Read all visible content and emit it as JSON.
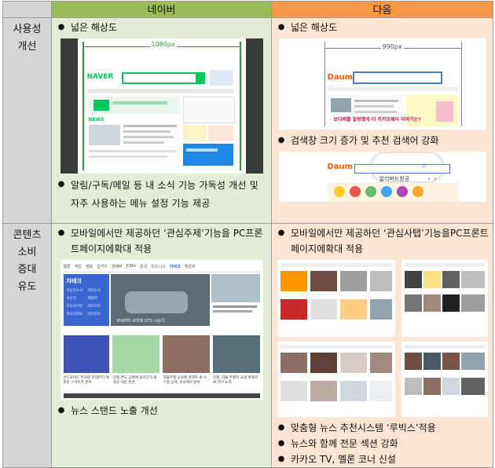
{
  "header": {
    "naver": "네이버",
    "daum": "다음"
  },
  "rows": [
    {
      "label": "사용성\n개선",
      "naver": {
        "bullets": [
          "넓은 해상도",
          "알림/구독/메일 등 내 소식 기능 가독성 개선 및 자주 사용하는 메뉴 설정 기능 제공"
        ],
        "shot": {
          "width_label": "1080px",
          "logo": "NAVER",
          "news_title": "NEWS"
        }
      },
      "daum": {
        "bullets": [
          "넓은 해상도",
          "검색창 크기 증가 및 추천 검색어 강화"
        ],
        "shot1": {
          "width_label": "990px",
          "logo": "Daum",
          "banner": "보다에를 알랑했게 더 카카오페이 이야기는?"
        },
        "shot2": {
          "logo": "Daum",
          "search_text": "얼리버드항공"
        }
      }
    },
    {
      "label": "콘텐츠\n소비\n증대\n유도",
      "naver": {
        "bullets": [
          "모바일에서만  제공하던 ‘관심주제’기능을 PC프론트페이지에확대 적용",
          "뉴스 스탠드 노출 개선"
        ],
        "shot": {
          "tabs": [
            "웹툰",
            "게임",
            "영화",
            "힙커즈",
            "경제M",
            "JOB&",
            "중국",
            "비즈니스",
            "차테크",
            "책문화"
          ],
          "panel_title": "차테크",
          "panel_items": [
            "자동차소식",
            "테크소식",
            "국산차",
            "해외차",
            "자동차리뷰",
            "테크리뷰",
            "자동차정보",
            "테크정보"
          ],
          "captions": [
            "안드로이드 폰처럼 현대부터 페로운 스마트폰 준비",
            "단종 폰도 공백에 들어간가 새로운 쉬운 발견",
            "자율주행 공식에 현대차 새 시스템 공개, 한국에서 준비",
            "진행, 자율 주행차 국내 위에서 AI 연구 노력"
          ],
          "big_caption": "마세라티 르반테 GTS 시승기"
        }
      },
      "daum": {
        "bullets": [
          "모바일에서만  제공하던 ‘관심사탭’기능을PC프론트페이지에확대 적용",
          "맞춤형 뉴스 추천시스템 ‘루빅스’적용",
          "뉴스와 함께 전문 섹션 강화",
          "카카오 TV, 멜론 코너 신설"
        ]
      }
    }
  ],
  "colors": {
    "header_naver": "#9bbb59",
    "header_daum": "#f79646",
    "cell_naver": "#e3edd5",
    "cell_daum": "#fde5d2",
    "label_bg": "#d6d6d6",
    "naver_green": "#03c75a",
    "daum_orange": "#ff5a00"
  },
  "icons": [
    "bullet-dot-icon",
    "search-icon",
    "chevron-left-icon",
    "chevron-right-icon"
  ]
}
